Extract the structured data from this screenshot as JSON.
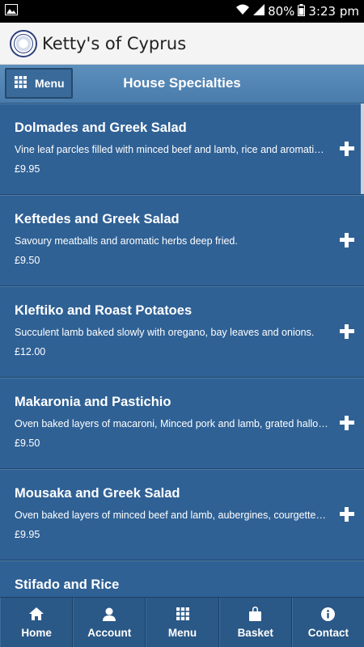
{
  "status_bar": {
    "battery_percent": "80%",
    "time": "3:23 pm",
    "icons": [
      "image-icon",
      "wifi-icon",
      "signal-icon",
      "battery-icon"
    ]
  },
  "app_bar": {
    "title": "Ketty's of Cyprus",
    "logo_icon": "restaurant-logo"
  },
  "header": {
    "menu_label": "Menu",
    "title": "House Specialties"
  },
  "items": [
    {
      "name": "Dolmades and Greek Salad",
      "description": "Vine leaf parcles filled with minced beef and lamb, rice and aromatic herbs",
      "price": "£9.95"
    },
    {
      "name": "Keftedes and Greek Salad",
      "description": "Savoury meatballs and aromatic herbs deep fried.",
      "price": "£9.50"
    },
    {
      "name": "Kleftiko and Roast Potatoes",
      "description": "Succulent lamb baked slowly with oregano, bay leaves and onions.",
      "price": "£12.00"
    },
    {
      "name": "Makaronia and Pastichio",
      "description": "Oven baked layers of macaroni, Minced pork and lamb, grated halloumi",
      "price": "£9.50"
    },
    {
      "name": "Mousaka and Greek Salad",
      "description": "Oven baked layers of minced beef and lamb, aubergines, courgettes and potatoes",
      "price": "£9.95"
    },
    {
      "name": "Stifado and Rice",
      "description": "",
      "price": ""
    }
  ],
  "tabs": [
    {
      "label": "Home",
      "icon": "home-icon"
    },
    {
      "label": "Account",
      "icon": "user-icon"
    },
    {
      "label": "Menu",
      "icon": "grid-icon"
    },
    {
      "label": "Basket",
      "icon": "basket-icon"
    },
    {
      "label": "Contact",
      "icon": "info-icon"
    }
  ],
  "colors": {
    "list_background": "#2f6195",
    "header_background": "#5d8fbd",
    "tabbar_background": "#2a5887"
  }
}
